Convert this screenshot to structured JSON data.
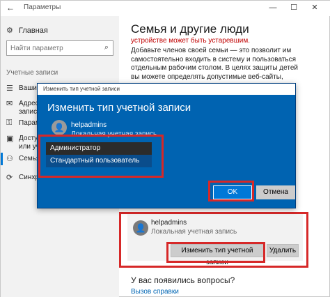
{
  "window": {
    "title": "Параметры",
    "back_icon": "back-arrow-icon",
    "minimize_glyph": "—",
    "maximize_glyph": "☐",
    "close_glyph": "✕"
  },
  "sidebar": {
    "home_label": "Главная",
    "search_placeholder": "Найти параметр",
    "section_label": "Учетные записи",
    "items": [
      {
        "icon": "user-info-icon",
        "label": "Ваши"
      },
      {
        "icon": "mail-icon",
        "label": "Адрес",
        "label2": "запися"
      },
      {
        "icon": "key-icon",
        "label": "Парамет"
      },
      {
        "icon": "briefcase-icon",
        "label": "Доступ",
        "label2": "или уче"
      },
      {
        "icon": "family-icon",
        "label": "Семья"
      },
      {
        "icon": "sync-icon",
        "label": "Синхр"
      }
    ]
  },
  "main": {
    "title": "Семья и другие люди",
    "warning": "устройстве может быть устаревшим.",
    "description": "Добавьте членов своей семьи — это позволит им самостоятельно входить в систему и пользоваться отдельным рабочим столом. В целях защиты детей вы можете определять допустимые веб-сайты, периоды времени, приложения и игры.",
    "account": {
      "name": "helpadmins",
      "type": "Локальная учетная запись",
      "change_button": "Изменить тип учетной записи",
      "delete_button": "Удалить"
    },
    "questions_title": "У вас появились вопросы?",
    "help_link": "Вызов справки"
  },
  "dialog": {
    "titlebar": "Изменить тип учетной записи",
    "heading": "Изменить тип учетной записи",
    "account_name": "helpadmins",
    "account_type": "Локальная учетная запись",
    "options": [
      "Администратор",
      "Стандартный пользователь"
    ],
    "selected_option": "Администратор",
    "ok_button": "OK",
    "cancel_button": "Отмена"
  },
  "colors": {
    "accent": "#0078d7",
    "dialog_bg": "#0063b1",
    "highlight_box": "#d62828",
    "warning_text": "#c00000"
  }
}
